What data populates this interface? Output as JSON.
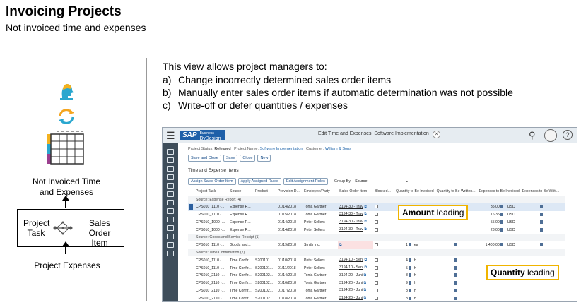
{
  "slide": {
    "title": "Invoicing Projects",
    "subtitle": "Not invoiced time and expenses"
  },
  "diagram": {
    "not_invoiced_label_line1": "Not Invoiced Time",
    "not_invoiced_label_line2": "and Expenses",
    "project_task_line1": "Project",
    "project_task_line2": "Task",
    "sales_order_item_line1": "Sales Order",
    "sales_order_item_line2": "Item",
    "project_expenses_label": "Project Expenses"
  },
  "intro": {
    "lead": "This view allows project managers to:",
    "items": [
      {
        "letter": "a)",
        "text": "Change incorrectly determined sales order items"
      },
      {
        "letter": "b)",
        "text": "Manually enter sales order items if automatic determination was not possible"
      },
      {
        "letter": "c)",
        "text": "Write-off or defer quantities / expenses"
      }
    ]
  },
  "app": {
    "brand": "SAP",
    "brand_sub_line1": "Business",
    "brand_sub_line2": "ByDesign",
    "window_title": "Edit Time and Expenses: Software Implementation",
    "status_label": "Project Status:",
    "status_value": "Released",
    "project_name_label": "Project Name:",
    "project_name_value": "Software Implementation",
    "customer_label": "Customer:",
    "customer_value": "William & Sons",
    "toolbar": {
      "save_close": "Save and Close",
      "save": "Save",
      "close": "Close",
      "new": "New"
    },
    "section_title": "Time and Expense Items",
    "section_buttons": {
      "assign": "Assign Sales Order Item",
      "apply": "Apply Assigned Rules",
      "edit": "Edit Assignment Rules",
      "group_by_label": "Group By",
      "group_by_value": "Source"
    },
    "columns": [
      "Project Task",
      "Source",
      "Product",
      "Provision D...",
      "Employee/Party",
      "Sales Order Item",
      "Blocked...",
      "Quantity to Be Invoiced",
      "Quantity to Be Written...",
      "Expenses to Be Invoiced",
      "Expenses to Be Writt..."
    ],
    "groups": [
      {
        "label": "Source: Expense Report (4)",
        "rows": [
          {
            "task": "CPS010_1110 -...",
            "source": "Expense R...",
            "product": "",
            "date": "01/14/2018",
            "party": "Tonia Gartner",
            "so_item": "3194-30 - Trav",
            "qty": "",
            "unit": "",
            "amount": "35.00",
            "currency": "USD"
          },
          {
            "task": "CPS010_1110 -...",
            "source": "Expense R...",
            "product": "",
            "date": "01/15/2018",
            "party": "Tonia Gartner",
            "so_item": "3194-30 - Trav",
            "qty": "",
            "unit": "",
            "amount": "16.35",
            "currency": "USD"
          },
          {
            "task": "CPS010_1000 -...",
            "source": "Expense R...",
            "product": "",
            "date": "01/14/2018",
            "party": "Peter Sellers",
            "so_item": "3194-30 - Trav",
            "qty": "",
            "unit": "",
            "amount": "55.00",
            "currency": "USD"
          },
          {
            "task": "CPS010_1000 -...",
            "source": "Expense R...",
            "product": "",
            "date": "01/14/2018",
            "party": "Peter Sellers",
            "so_item": "3194-30 - Trav",
            "qty": "",
            "unit": "",
            "amount": "28.00",
            "currency": "USD"
          }
        ]
      },
      {
        "label": "Source: Goods and Service Receipt (1)",
        "rows": [
          {
            "task": "CPS010_1110 -...",
            "source": "Goods and...",
            "product": "",
            "date": "01/19/2018",
            "party": "Smith Inc.",
            "so_item": "",
            "qty": "1",
            "unit": "ea",
            "amount": "1,400.00",
            "currency": "USD"
          }
        ]
      },
      {
        "label": "Source: Time Confirmation (7)",
        "rows": [
          {
            "task": "CPS010_1110 -...",
            "source": "Time Confir...",
            "product": "S200101...",
            "date": "01/10/2018",
            "party": "Peter Sellers",
            "so_item": "3194-10 - Seni",
            "qty": "4",
            "unit": "h",
            "amount": "",
            "currency": ""
          },
          {
            "task": "CPS010_1110 -...",
            "source": "Time Confir...",
            "product": "S200101...",
            "date": "01/11/2018",
            "party": "Peter Sellers",
            "so_item": "3194-10 - Seni",
            "qty": "5",
            "unit": "h",
            "amount": "",
            "currency": ""
          },
          {
            "task": "CPS010_2110 -...",
            "source": "Time Confir...",
            "product": "S200102...",
            "date": "01/14/2018",
            "party": "Tonia Gartner",
            "so_item": "3194-20 - Juni",
            "qty": "8",
            "unit": "h",
            "amount": "",
            "currency": ""
          },
          {
            "task": "CPS010_2110 -...",
            "source": "Time Confir...",
            "product": "S200102...",
            "date": "01/16/2018",
            "party": "Tonia Gartner",
            "so_item": "3194-20 - Juni",
            "qty": "9",
            "unit": "h",
            "amount": "",
            "currency": ""
          },
          {
            "task": "CPS010_2110 -...",
            "source": "Time Confir...",
            "product": "S200102...",
            "date": "01/17/2018",
            "party": "Tonia Gartner",
            "so_item": "3194-20 - Juni",
            "qty": "8",
            "unit": "h",
            "amount": "",
            "currency": ""
          },
          {
            "task": "CPS010_2110 -...",
            "source": "Time Confir...",
            "product": "S200102...",
            "date": "01/18/2018",
            "party": "Tonia Gartner",
            "so_item": "3194-20 - Juni",
            "qty": "8",
            "unit": "h",
            "amount": "",
            "currency": ""
          }
        ]
      }
    ]
  },
  "callouts": {
    "amount_bold": "Amount",
    "amount_rest": " leading",
    "quantity_bold": "Quantity",
    "quantity_rest": " leading"
  },
  "colors": {
    "accent": "#1e5fa8",
    "callout_border": "#f0b400",
    "sidebar": "#3e4d5a"
  }
}
